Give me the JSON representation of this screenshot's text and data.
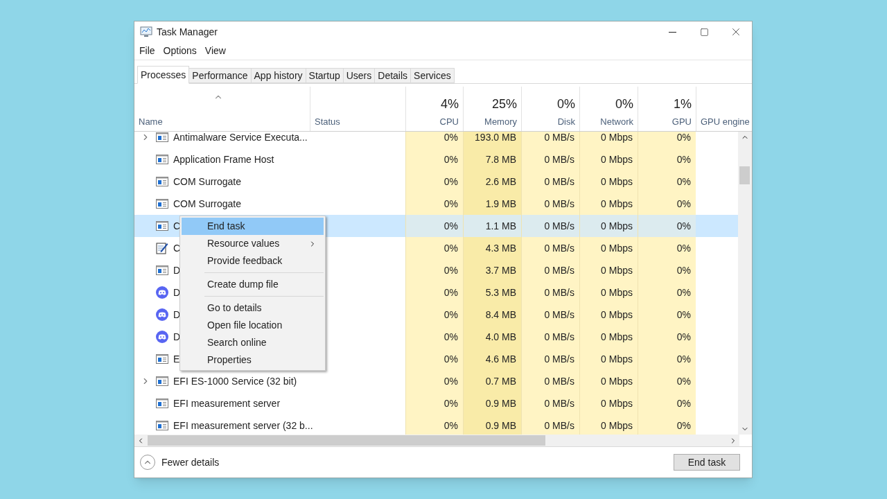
{
  "window": {
    "title": "Task Manager"
  },
  "menu_bar": [
    "File",
    "Options",
    "View"
  ],
  "tabs": [
    {
      "label": "Processes",
      "selected": true
    },
    {
      "label": "Performance",
      "selected": false
    },
    {
      "label": "App history",
      "selected": false
    },
    {
      "label": "Startup",
      "selected": false
    },
    {
      "label": "Users",
      "selected": false
    },
    {
      "label": "Details",
      "selected": false
    },
    {
      "label": "Services",
      "selected": false
    }
  ],
  "table": {
    "columns": [
      {
        "label": "Name",
        "sorted": true
      },
      {
        "label": "Status"
      },
      {
        "percent": "4%",
        "label": "CPU"
      },
      {
        "percent": "25%",
        "label": "Memory"
      },
      {
        "percent": "0%",
        "label": "Disk"
      },
      {
        "percent": "0%",
        "label": "Network"
      },
      {
        "percent": "1%",
        "label": "GPU"
      },
      {
        "label": "GPU engine"
      }
    ],
    "rows": [
      {
        "expandable": true,
        "kind": "app",
        "name": "Antimalware Service Executa...",
        "selected": false,
        "cpu": "0%",
        "memory": "193.0 MB",
        "disk": "0 MB/s",
        "network": "0 Mbps",
        "gpu": "0%"
      },
      {
        "expandable": false,
        "kind": "app",
        "name": "Application Frame Host",
        "selected": false,
        "cpu": "0%",
        "memory": "7.8 MB",
        "disk": "0 MB/s",
        "network": "0 Mbps",
        "gpu": "0%"
      },
      {
        "expandable": false,
        "kind": "app",
        "name": "COM Surrogate",
        "selected": false,
        "cpu": "0%",
        "memory": "2.6 MB",
        "disk": "0 MB/s",
        "network": "0 Mbps",
        "gpu": "0%"
      },
      {
        "expandable": false,
        "kind": "app",
        "name": "COM Surrogate",
        "selected": false,
        "cpu": "0%",
        "memory": "1.9 MB",
        "disk": "0 MB/s",
        "network": "0 Mbps",
        "gpu": "0%"
      },
      {
        "expandable": false,
        "kind": "app",
        "name": "C",
        "selected": true,
        "cpu": "0%",
        "memory": "1.1 MB",
        "disk": "0 MB/s",
        "network": "0 Mbps",
        "gpu": "0%"
      },
      {
        "expandable": false,
        "kind": "notepad",
        "name": "C",
        "selected": false,
        "cpu": "0%",
        "memory": "4.3 MB",
        "disk": "0 MB/s",
        "network": "0 Mbps",
        "gpu": "0%"
      },
      {
        "expandable": false,
        "kind": "app",
        "name": "D",
        "selected": false,
        "cpu": "0%",
        "memory": "3.7 MB",
        "disk": "0 MB/s",
        "network": "0 Mbps",
        "gpu": "0%"
      },
      {
        "expandable": false,
        "kind": "chat",
        "name": "D",
        "selected": false,
        "cpu": "0%",
        "memory": "5.3 MB",
        "disk": "0 MB/s",
        "network": "0 Mbps",
        "gpu": "0%"
      },
      {
        "expandable": false,
        "kind": "chat",
        "name": "D",
        "selected": false,
        "cpu": "0%",
        "memory": "8.4 MB",
        "disk": "0 MB/s",
        "network": "0 Mbps",
        "gpu": "0%"
      },
      {
        "expandable": false,
        "kind": "chat",
        "name": "D",
        "selected": false,
        "cpu": "0%",
        "memory": "4.0 MB",
        "disk": "0 MB/s",
        "network": "0 Mbps",
        "gpu": "0%"
      },
      {
        "expandable": false,
        "kind": "app",
        "name": "E",
        "selected": false,
        "cpu": "0%",
        "memory": "4.6 MB",
        "disk": "0 MB/s",
        "network": "0 Mbps",
        "gpu": "0%"
      },
      {
        "expandable": true,
        "kind": "app",
        "name": "EFI ES-1000 Service (32 bit)",
        "selected": false,
        "cpu": "0%",
        "memory": "0.7 MB",
        "disk": "0 MB/s",
        "network": "0 Mbps",
        "gpu": "0%"
      },
      {
        "expandable": false,
        "kind": "app",
        "name": "EFI measurement server",
        "selected": false,
        "cpu": "0%",
        "memory": "0.9 MB",
        "disk": "0 MB/s",
        "network": "0 Mbps",
        "gpu": "0%"
      },
      {
        "expandable": false,
        "kind": "app",
        "name": "EFI measurement server (32 b...",
        "selected": false,
        "cpu": "0%",
        "memory": "0.9 MB",
        "disk": "0 MB/s",
        "network": "0 Mbps",
        "gpu": "0%"
      }
    ]
  },
  "context_menu": {
    "groups": [
      [
        {
          "label": "End task",
          "selected": true,
          "submenu": false
        },
        {
          "label": "Resource values",
          "selected": false,
          "submenu": true
        },
        {
          "label": "Provide feedback",
          "selected": false,
          "submenu": false
        }
      ],
      [
        {
          "label": "Create dump file",
          "selected": false,
          "submenu": false
        }
      ],
      [
        {
          "label": "Go to details",
          "selected": false,
          "submenu": false
        },
        {
          "label": "Open file location",
          "selected": false,
          "submenu": false
        },
        {
          "label": "Search online",
          "selected": false,
          "submenu": false
        },
        {
          "label": "Properties",
          "selected": false,
          "submenu": false
        }
      ]
    ]
  },
  "footer": {
    "toggle": "Fewer details",
    "button": "End task"
  }
}
